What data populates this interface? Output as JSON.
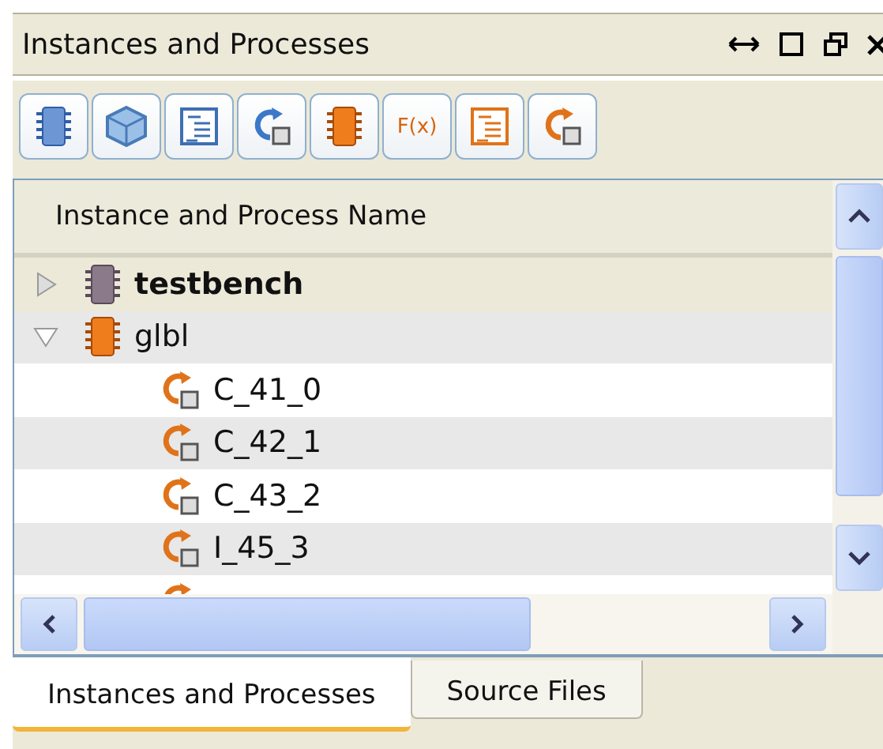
{
  "window": {
    "title": "Instances and Processes"
  },
  "toolbar": [
    {
      "kind": "chip-blue"
    },
    {
      "kind": "cube"
    },
    {
      "kind": "doc-blue"
    },
    {
      "kind": "process-blue"
    },
    {
      "kind": "chip-orange"
    },
    {
      "kind": "function",
      "label": "F(x)"
    },
    {
      "kind": "doc-orange"
    },
    {
      "kind": "process-orange"
    }
  ],
  "tree": {
    "column": "Instance and Process Name",
    "items": [
      {
        "label": "testbench",
        "kind": "module-grey",
        "bold": true,
        "selected": true,
        "expanded": false
      },
      {
        "label": "glbl",
        "kind": "module-orange",
        "bold": false,
        "selected": false,
        "expanded": true,
        "children": [
          {
            "label": "C_41_0",
            "kind": "process",
            "selected": false
          },
          {
            "label": "C_42_1",
            "kind": "process",
            "selected": false
          },
          {
            "label": "C_43_2",
            "kind": "process",
            "selected": false
          },
          {
            "label": "I_45_3",
            "kind": "process",
            "selected": false
          },
          {
            "kind": "process",
            "selected": false
          }
        ]
      }
    ]
  },
  "tabs": [
    {
      "label": "Instances and Processes",
      "selected": true
    },
    {
      "label": "Source Files",
      "selected": false
    }
  ]
}
